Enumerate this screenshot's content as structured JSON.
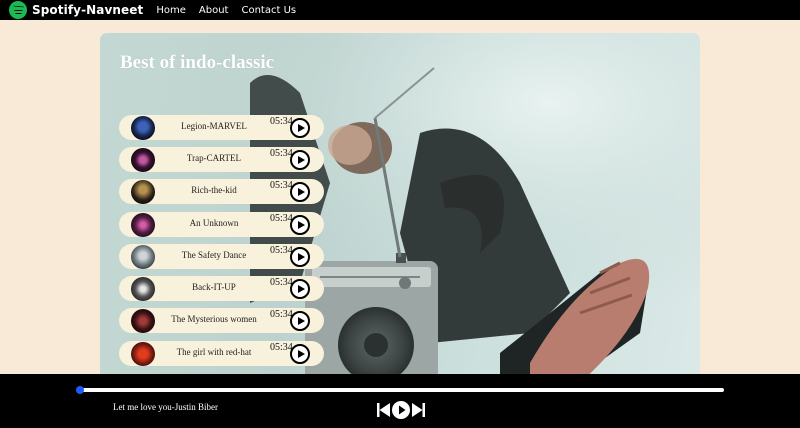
{
  "nav": {
    "brand": "Spotify-Navneet",
    "links": [
      "Home",
      "About",
      "Contact Us"
    ]
  },
  "playlist": {
    "title": "Best of indo-classic",
    "songs": [
      {
        "name": "Legion-MARVEL",
        "duration": "05:34"
      },
      {
        "name": "Trap-CARTEL",
        "duration": "05:34"
      },
      {
        "name": "Rich-the-kid",
        "duration": "05:34"
      },
      {
        "name": "An Unknown",
        "duration": "05:34"
      },
      {
        "name": "The Safety Dance",
        "duration": "05:34"
      },
      {
        "name": "Back-IT-UP",
        "duration": "05:34"
      },
      {
        "name": "The Mysterious women",
        "duration": "05:34"
      },
      {
        "name": "The girl with red-hat",
        "duration": "05:34"
      }
    ]
  },
  "player": {
    "now_playing": "Let me love you-Justin Biber",
    "progress": 0.005
  },
  "colors": {
    "nav_bg": "#000000",
    "page_bg": "#f9ead8",
    "song_pill": "#f8f2dc",
    "progress_knob": "#1e5bff",
    "brand_green": "#1db954"
  },
  "icons": [
    "spotify-logo-icon",
    "play-icon",
    "previous-icon",
    "pause-icon",
    "next-icon"
  ]
}
